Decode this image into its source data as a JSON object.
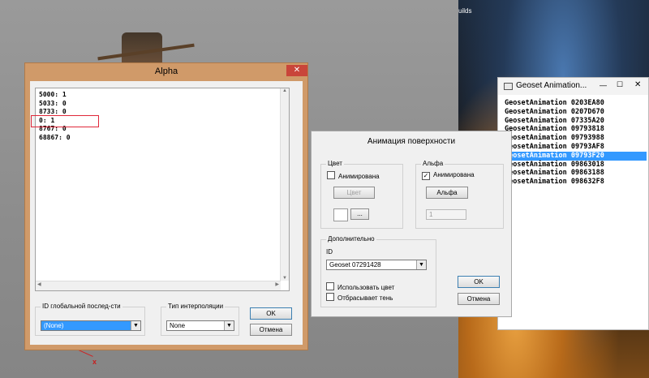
{
  "background": {
    "top_label": "uilds",
    "marker": "x"
  },
  "alpha_window": {
    "title": "Alpha",
    "close_glyph": "✕",
    "lines": [
      "5000: 1",
      "5033: 0",
      "8733: 0",
      "0: 1",
      "8767: 0",
      "68867: 0"
    ],
    "global_seq_label": "ID глобальной послед-сти",
    "global_seq_value": "(None)",
    "interp_label": "Тип интерполяции",
    "interp_value": "None",
    "ok_label": "OK",
    "cancel_label": "Отмена"
  },
  "surface_window": {
    "title": "Анимация поверхности",
    "color_group": "Цвет",
    "color_animated": "Анимирована",
    "color_button": "Цвет",
    "dots_button": "...",
    "alpha_group": "Альфа",
    "alpha_animated": "Анимирована",
    "alpha_button": "Альфа",
    "alpha_value": "1",
    "extra_group": "Дополнительно",
    "id_label": "ID",
    "geoset_value": "Geoset 07291428",
    "use_color": "Использовать цвет",
    "casts_shadow": "Отбрасывает тень",
    "ok_label": "OK",
    "cancel_label": "Отмена"
  },
  "geoset_window": {
    "title": "Geoset Animation...",
    "minimize_glyph": "—",
    "maximize_glyph": "☐",
    "close_glyph": "✕",
    "items": [
      "GeosetAnimation 0203EA80",
      "GeosetAnimation 0207D670",
      "GeosetAnimation 07335A20",
      "GeosetAnimation 09793818",
      "GeosetAnimation 09793988",
      "GeosetAnimation 09793AF8",
      "GeosetAnimation 09793F20",
      "GeosetAnimation 09863018",
      "GeosetAnimation 09863188",
      "GeosetAnimation 098632F8"
    ],
    "selected_index": 6
  },
  "colors": {
    "accent_orange": "#d09a69",
    "selection": "#3399ff",
    "highlight_box": "#e0283a"
  }
}
